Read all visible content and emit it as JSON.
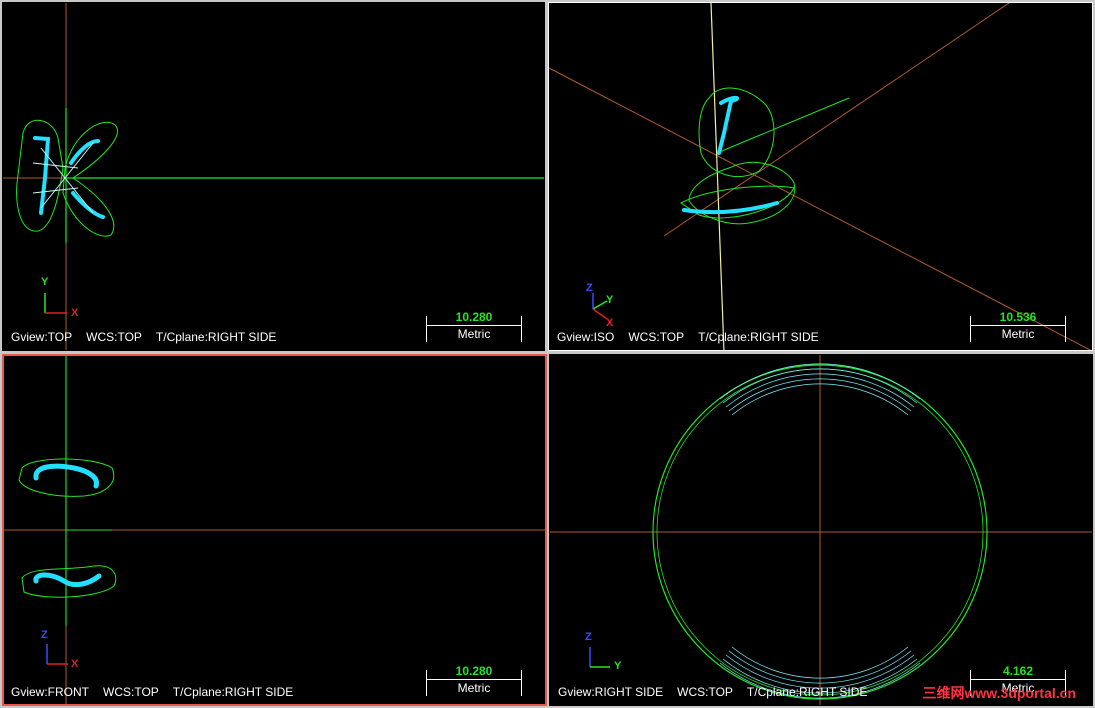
{
  "viewports": {
    "top": {
      "gview": "Gview:TOP",
      "wcs": "WCS:TOP",
      "cplane": "T/Cplane:RIGHT SIDE",
      "scale_value": "10.280",
      "scale_unit": "Metric"
    },
    "iso": {
      "gview": "Gview:ISO",
      "wcs": "WCS:TOP",
      "cplane": "T/Cplane:RIGHT SIDE",
      "scale_value": "10.536",
      "scale_unit": "Metric"
    },
    "front": {
      "gview": "Gview:FRONT",
      "wcs": "WCS:TOP",
      "cplane": "T/Cplane:RIGHT SIDE",
      "scale_value": "10.280",
      "scale_unit": "Metric"
    },
    "right": {
      "gview": "Gview:RIGHT SIDE",
      "wcs": "WCS:TOP",
      "cplane": "T/Cplane:RIGHT SIDE",
      "scale_value": "4.162",
      "scale_unit": "Metric"
    }
  },
  "axis_labels": {
    "x": "X",
    "y": "Y",
    "z": "Z"
  },
  "watermark": "三维网www.3dportal.cn",
  "colors": {
    "background": "#000000",
    "toolpath": "#22e0ff",
    "geometry": "#22e622",
    "axis_line": "#b05a2a",
    "active_border": "#e8584a",
    "scale_value": "#22e622"
  }
}
